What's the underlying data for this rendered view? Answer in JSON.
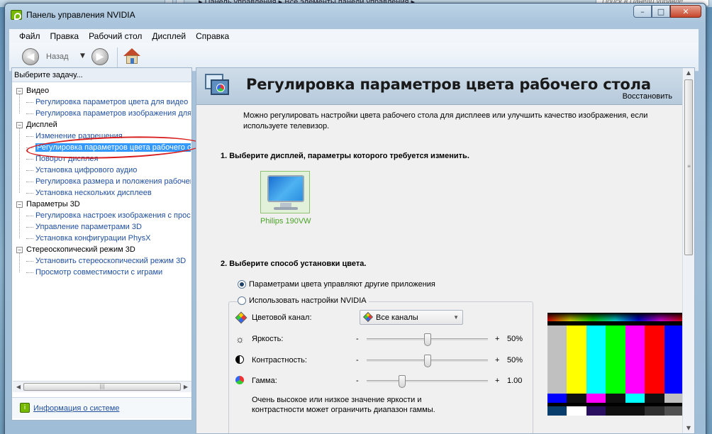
{
  "background": {
    "breadcrumbs": "▸ Панель управления  ▸  Все элементы панели управления  ▸",
    "search_placeholder": "Поиск в Панели управле..."
  },
  "window": {
    "title": "Панель управления NVIDIA",
    "btn_min": "–",
    "btn_max": "□",
    "btn_close": "✕"
  },
  "menu": [
    "Файл",
    "Правка",
    "Рабочий стол",
    "Дисплей",
    "Справка"
  ],
  "toolbar": {
    "back_label": "Назад",
    "back_icon": "arrow-left",
    "forward_icon": "arrow-right"
  },
  "left": {
    "header": "Выберите задачу...",
    "tree": [
      {
        "type": "cat",
        "label": "Видео"
      },
      {
        "type": "item",
        "label": "Регулировка параметров цвета для видео"
      },
      {
        "type": "item",
        "label": "Регулировка параметров изображения для видео"
      },
      {
        "type": "cat",
        "label": "Дисплей"
      },
      {
        "type": "item",
        "label": "Изменение разрешения"
      },
      {
        "type": "item",
        "label": "Регулировка параметров цвета рабочего стола",
        "selected": true
      },
      {
        "type": "item",
        "label": "Поворот дисплея"
      },
      {
        "type": "item",
        "label": "Установка цифрового аудио"
      },
      {
        "type": "item",
        "label": "Регулировка размера и положения рабочего стола"
      },
      {
        "type": "item",
        "label": "Установка нескольких дисплеев"
      },
      {
        "type": "cat",
        "label": "Параметры 3D"
      },
      {
        "type": "item",
        "label": "Регулировка настроек изображения с просмотром"
      },
      {
        "type": "item",
        "label": "Управление параметрами 3D"
      },
      {
        "type": "item",
        "label": "Установка конфигурации PhysX"
      },
      {
        "type": "cat",
        "label": "Стереоскопический режим 3D"
      },
      {
        "type": "item",
        "label": "Установить стереоскопический режим 3D"
      },
      {
        "type": "item",
        "label": "Просмотр совместимости с играми"
      }
    ],
    "sysinfo_link": "Информация о системе"
  },
  "right": {
    "title": "Регулировка параметров цвета рабочего стола",
    "restore": "Восстановить",
    "description": "Можно регулировать настройки цвета рабочего стола для дисплеев или улучшить качество изображения, если используете телевизор.",
    "step1": "1. Выберите дисплей, параметры которого требуется изменить.",
    "display_name": "Philips 190VW",
    "step2": "2. Выберите способ установки цвета.",
    "radio_other_apps": "Параметрами цвета управляют другие приложения",
    "radio_nvidia": "Использовать настройки NVIDIA",
    "channel_label": "Цветовой канал:",
    "channel_value": "Все каналы",
    "controls": [
      {
        "label": "Яркость:",
        "minus": "-",
        "plus": "+",
        "value": "50%",
        "level": 0.5,
        "icon": "sun-icon"
      },
      {
        "label": "Контрастность:",
        "minus": "-",
        "plus": "+",
        "value": "50%",
        "level": 0.5,
        "icon": "contrast-icon"
      },
      {
        "label": "Гамма:",
        "minus": "-",
        "plus": "+",
        "value": "1.00",
        "level": 0.29,
        "icon": "gamma-icon"
      }
    ],
    "note": "Очень высокое или низкое значение яркости и контрастности может ограничить диапазон гаммы.",
    "test_pattern_colors": {
      "bars": [
        "#c0c0c0",
        "#ffff00",
        "#00ffff",
        "#00ff00",
        "#ff00ff",
        "#ff0000",
        "#0000ff"
      ],
      "low": [
        "#0000ff",
        "#101010",
        "#ff00ff",
        "#101010",
        "#00ffff",
        "#101010",
        "#c0c0c0"
      ],
      "bottom": [
        "#083e6e",
        "#ffffff",
        "#2a0f60",
        "#101010",
        "#101010",
        "#303030",
        "#505050"
      ]
    }
  }
}
